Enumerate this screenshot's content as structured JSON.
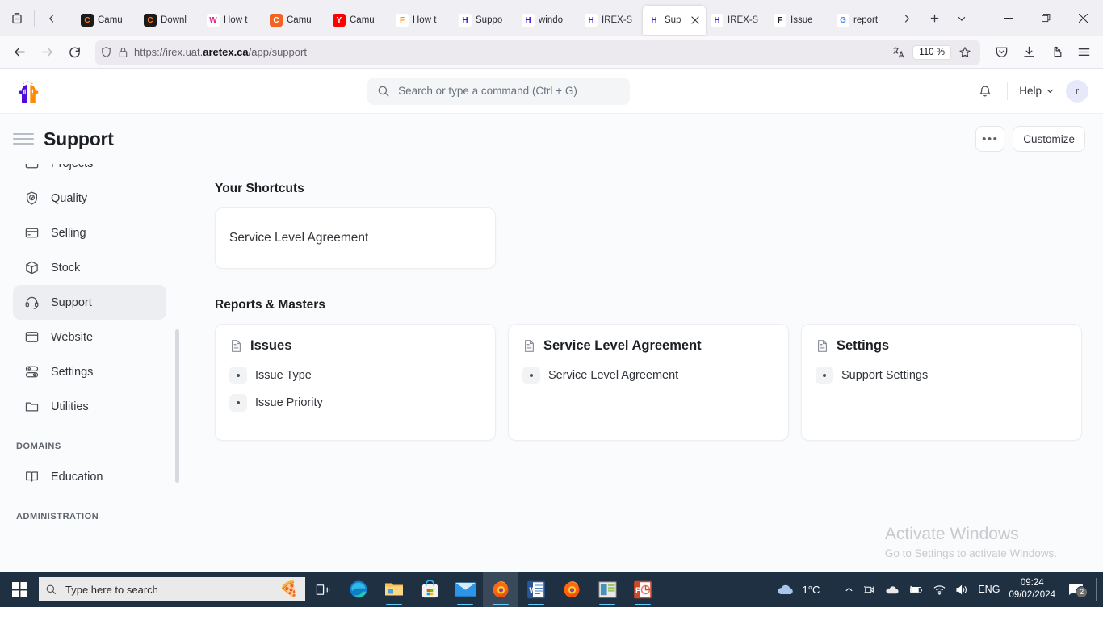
{
  "browser": {
    "tabs": [
      {
        "title": "Camu",
        "fav": "C",
        "fav_bg": "#1b1b1b",
        "fav_fg": "#ff7a1a",
        "active": false
      },
      {
        "title": "Downl",
        "fav": "C",
        "fav_bg": "#1b1b1b",
        "fav_fg": "#ff7a1a",
        "active": false
      },
      {
        "title": "How t",
        "fav": "W",
        "fav_bg": "#ffffff",
        "fav_fg": "#e0218a",
        "active": false
      },
      {
        "title": "Camu",
        "fav": "C",
        "fav_bg": "#f26322",
        "fav_fg": "#ffffff",
        "active": false
      },
      {
        "title": "Camu",
        "fav": "Y",
        "fav_bg": "#ff0000",
        "fav_fg": "#ffffff",
        "active": false
      },
      {
        "title": "How t",
        "fav": "F",
        "fav_bg": "#ffffff",
        "fav_fg": "#ff9500",
        "active": false
      },
      {
        "title": "Suppo",
        "fav": "H",
        "fav_bg": "#ffffff",
        "fav_fg": "#4b0edb",
        "active": false
      },
      {
        "title": "windo",
        "fav": "H",
        "fav_bg": "#ffffff",
        "fav_fg": "#4b0edb",
        "active": false
      },
      {
        "title": "IREX-S",
        "fav": "H",
        "fav_bg": "#ffffff",
        "fav_fg": "#4b0edb",
        "active": false
      },
      {
        "title": "Sup",
        "fav": "H",
        "fav_bg": "#ffffff",
        "fav_fg": "#4b0edb",
        "active": true
      },
      {
        "title": "IREX-S",
        "fav": "H",
        "fav_bg": "#ffffff",
        "fav_fg": "#4b0edb",
        "active": false
      },
      {
        "title": "Issue",
        "fav": "F",
        "fav_bg": "#ffffff",
        "fav_fg": "#1c2024",
        "active": false
      },
      {
        "title": "report",
        "fav": "G",
        "fav_bg": "#ffffff",
        "fav_fg": "#4285f4",
        "active": false
      }
    ],
    "icons": {
      "list_all_tabs": "list-all-tabs-icon",
      "back": "back-arrow-icon",
      "forward": "forward-arrow-icon",
      "reload": "reload-icon",
      "new_tab": "new-tab-plus-icon",
      "tab_overflow": "tab-overflow-chevron-icon",
      "minimize": "minimize-icon",
      "maximize": "maximize-icon",
      "close_window": "close-window-icon",
      "shield": "shield-icon",
      "lock": "padlock-icon",
      "translate": "translate-icon",
      "bookmark": "bookmark-star-icon",
      "pocket": "save-to-pocket-icon",
      "downloads": "downloads-icon",
      "extensions": "extensions-puzzle-icon",
      "app_menu": "hamburger-menu-icon"
    },
    "url": {
      "prefix": "https://irex.uat.",
      "domain": "aretex.ca",
      "path": "/app/support",
      "full": "https://irex.uat.aretex.ca/app/support"
    },
    "zoom_level": "110 %"
  },
  "app": {
    "logo_name": "aretex-two-heads-logo",
    "search": {
      "placeholder": "Search or type a command (Ctrl + G)",
      "value": "",
      "icon": "search-icon"
    },
    "notifications_icon": "bell-icon",
    "help_label": "Help",
    "help_chevron": "chevron-down-icon",
    "avatar_initial": "r",
    "header": {
      "menu_icon": "hamburger-menu-icon",
      "title": "Support",
      "more_label": "•••",
      "customize_label": "Customize"
    },
    "sidebar": {
      "items": [
        {
          "label": "Projects",
          "icon": "projects-icon",
          "active": false
        },
        {
          "label": "Quality",
          "icon": "quality-shield-icon",
          "active": false
        },
        {
          "label": "Selling",
          "icon": "selling-card-icon",
          "active": false
        },
        {
          "label": "Stock",
          "icon": "stock-box-icon",
          "active": false
        },
        {
          "label": "Support",
          "icon": "support-headset-icon",
          "active": true
        },
        {
          "label": "Website",
          "icon": "website-browser-icon",
          "active": false
        },
        {
          "label": "Settings",
          "icon": "settings-sliders-icon",
          "active": false
        },
        {
          "label": "Utilities",
          "icon": "utilities-folder-icon",
          "active": false
        }
      ],
      "group_domains_label": "DOMAINS",
      "domains": [
        {
          "label": "Education",
          "icon": "education-book-icon"
        }
      ],
      "group_administration_label": "ADMINISTRATION"
    },
    "main": {
      "shortcuts_title": "Your Shortcuts",
      "shortcuts": [
        {
          "label": "Service Level Agreement"
        }
      ],
      "reports_title": "Reports & Masters",
      "cards": [
        {
          "title": "Issues",
          "icon": "document-icon",
          "links": [
            {
              "label": "Issue Type"
            },
            {
              "label": "Issue Priority"
            }
          ]
        },
        {
          "title": "Service Level Agreement",
          "icon": "document-icon",
          "links": [
            {
              "label": "Service Level Agreement"
            }
          ]
        },
        {
          "title": "Settings",
          "icon": "document-icon",
          "links": [
            {
              "label": "Support Settings"
            }
          ]
        }
      ]
    },
    "watermark": {
      "line1": "Activate Windows",
      "line2": "Go to Settings to activate Windows."
    },
    "colors": {
      "accent": "#4b0edb",
      "brand_orange": "#f26322",
      "sidebar_active_bg": "#edeef1",
      "page_bg": "#fafbfc"
    }
  },
  "taskbar": {
    "start_icon": "windows-start-icon",
    "search_placeholder": "Type here to search",
    "search_emoji": "🍕",
    "search_icon": "search-icon",
    "task_view_icon": "task-view-icon",
    "apps": [
      {
        "name": "edge-icon",
        "running": false,
        "active": false
      },
      {
        "name": "file-explorer-icon",
        "running": true,
        "active": false
      },
      {
        "name": "microsoft-store-icon",
        "running": false,
        "active": false
      },
      {
        "name": "mail-icon",
        "running": true,
        "active": false
      },
      {
        "name": "firefox-icon",
        "running": true,
        "active": true
      },
      {
        "name": "word-icon",
        "running": true,
        "active": false
      },
      {
        "name": "firefox-icon",
        "running": false,
        "active": false
      },
      {
        "name": "sticky-notes-icon",
        "running": true,
        "active": false
      },
      {
        "name": "powerpoint-icon",
        "running": true,
        "active": false
      }
    ],
    "tray": {
      "weather_icon": "cloud-icon",
      "temperature": "1°C",
      "overflow_icon": "chevron-up-icon",
      "camera_icon": "camera-icon",
      "onedrive_icon": "onedrive-cloud-icon",
      "battery_icon": "battery-charging-icon",
      "wifi_icon": "wifi-icon",
      "volume_icon": "speaker-icon",
      "language": "ENG",
      "time": "09:24",
      "date": "09/02/2024",
      "notification_icon": "notification-center-icon",
      "notification_count": "2"
    }
  }
}
